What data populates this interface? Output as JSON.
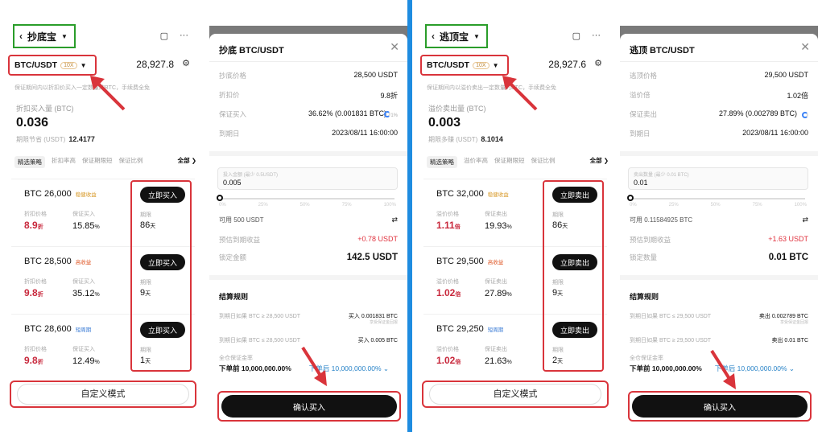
{
  "buy_screen": {
    "title": "抄底宝",
    "pair": "BTC/USDT",
    "leverage": "10X",
    "price": "28,927.8",
    "description": "保证期间内以折扣价买入一定数量的BTC，手续费全免",
    "qty_label": "折扣买入量 (BTC)",
    "qty_value": "0.036",
    "sub_label": "期限节省 (USDT)",
    "sub_value": "12.4177",
    "tabs": [
      "精选策略",
      "折扣率高",
      "保证期限短",
      "保证比例"
    ],
    "tab_all": "全部 ❯",
    "cards": [
      {
        "title": "BTC 26,000",
        "tag": "稳健收益",
        "col1_label": "折扣价格",
        "col1_value": "8.9",
        "col1_unit": "折",
        "col2_label": "保证买入",
        "col2_value": "15.85",
        "col2_unit": "%",
        "button": "立即买入",
        "term_label": "期限",
        "term_value": "86",
        "term_unit": "天"
      },
      {
        "title": "BTC 28,500",
        "tag": "高收益",
        "col1_label": "折扣价格",
        "col1_value": "9.8",
        "col1_unit": "折",
        "col2_label": "保证买入",
        "col2_value": "35.12",
        "col2_unit": "%",
        "button": "立即买入",
        "term_label": "期限",
        "term_value": "9",
        "term_unit": "天"
      },
      {
        "title": "BTC 28,600",
        "tag": "短周期",
        "col1_label": "折扣价格",
        "col1_value": "9.8",
        "col1_unit": "折",
        "col2_label": "保证买入",
        "col2_value": "12.49",
        "col2_unit": "%",
        "button": "立即买入",
        "term_label": "期限",
        "term_value": "1",
        "term_unit": "天"
      }
    ],
    "custom_button": "自定义模式"
  },
  "buy_modal": {
    "title": "抄底 BTC/USDT",
    "rows": [
      {
        "k": "抄底价格",
        "v": "28,500 USDT"
      },
      {
        "k": "折扣价",
        "v": "9.8折"
      },
      {
        "k": "保证买入",
        "v": "36.62% (0.001831 BTC)"
      },
      {
        "k": "到期日",
        "v": "2023/08/11 16:00:00"
      }
    ],
    "circle_text": "1%",
    "input_placeholder": "投入金额 (最少 0.5USDT)",
    "input_value": "0.005",
    "ticks": [
      "0%",
      "25%",
      "50%",
      "75%",
      "100%"
    ],
    "avail": "可用 500 USDT",
    "swap_icon": "⇄",
    "expected_label": "预估到期收益",
    "expected_value": "+0.78 USDT",
    "lock_label": "锁定金额",
    "lock_value": "142.5 USDT",
    "rules_title": "结算规则",
    "rule1_label": "到期日如果 BTC ≥ 28,500 USDT",
    "rule1_value": "买入 0.001831 BTC",
    "rule1_sub": "享受保证金回报",
    "rule2_label": "到期日如果 BTC ≤ 28,500 USDT",
    "rule2_value": "买入 0.005 BTC",
    "margin_label": "全仓保证金率",
    "margin_before": "下单前 10,000,000.00%",
    "margin_after": "下单后 10,000,000.00% ⌄",
    "confirm": "确认买入"
  },
  "sell_screen": {
    "title": "逃顶宝",
    "pair": "BTC/USDT",
    "leverage": "10X",
    "price": "28,927.6",
    "description": "保证期间内以溢价卖出一定数量的BTC，手续费全免",
    "qty_label": "溢价卖出量 (BTC)",
    "qty_value": "0.003",
    "sub_label": "期限多赚 (USDT)",
    "sub_value": "8.1014",
    "tabs": [
      "精选策略",
      "溢价率高",
      "保证期限短",
      "保证比例"
    ],
    "tab_all": "全部 ❯",
    "cards": [
      {
        "title": "BTC 32,000",
        "tag": "稳健收益",
        "col1_label": "溢价价格",
        "col1_value": "1.11",
        "col1_unit": "倍",
        "col2_label": "保证卖出",
        "col2_value": "19.93",
        "col2_unit": "%",
        "button": "立即卖出",
        "term_label": "期限",
        "term_value": "86",
        "term_unit": "天"
      },
      {
        "title": "BTC 29,500",
        "tag": "高收益",
        "col1_label": "溢价价格",
        "col1_value": "1.02",
        "col1_unit": "倍",
        "col2_label": "保证卖出",
        "col2_value": "27.89",
        "col2_unit": "%",
        "button": "立即卖出",
        "term_label": "期限",
        "term_value": "9",
        "term_unit": "天"
      },
      {
        "title": "BTC 29,250",
        "tag": "短周期",
        "col1_label": "溢价价格",
        "col1_value": "1.02",
        "col1_unit": "倍",
        "col2_label": "保证卖出",
        "col2_value": "21.63",
        "col2_unit": "%",
        "button": "立即卖出",
        "term_label": "期限",
        "term_value": "2",
        "term_unit": "天"
      }
    ],
    "custom_button": "自定义模式"
  },
  "sell_modal": {
    "title": "逃顶 BTC/USDT",
    "rows": [
      {
        "k": "逃顶价格",
        "v": "29,500 USDT"
      },
      {
        "k": "溢价倍",
        "v": "1.02倍"
      },
      {
        "k": "保证卖出",
        "v": "27.89% (0.002789 BTC)"
      },
      {
        "k": "到期日",
        "v": "2023/08/11 16:00:00"
      }
    ],
    "circle_text": "",
    "input_placeholder": "卖出数量 (最少 0.01 BTC)",
    "input_value": "0.01",
    "ticks": [
      "0%",
      "25%",
      "50%",
      "75%",
      "100%"
    ],
    "avail": "可用 0.11584925 BTC",
    "swap_icon": "⇄",
    "expected_label": "预估到期收益",
    "expected_value": "+1.63 USDT",
    "lock_label": "锁定数量",
    "lock_value": "0.01 BTC",
    "rules_title": "结算规则",
    "rule1_label": "到期日如果 BTC ≤ 29,500 USDT",
    "rule1_value": "卖出 0.002789 BTC",
    "rule1_sub": "享受保证金回报",
    "rule2_label": "到期日如果 BTC ≥ 29,500 USDT",
    "rule2_value": "卖出 0.01 BTC",
    "margin_label": "全仓保证金率",
    "margin_before": "下单前 10,000,000.00%",
    "margin_after": "下单后 10,000,000.00% ⌄",
    "confirm": "确认买入"
  },
  "colors": {
    "highlight_red": "#d9343b",
    "highlight_green": "#2a9d2a",
    "divider_blue": "#1e8ce0"
  }
}
